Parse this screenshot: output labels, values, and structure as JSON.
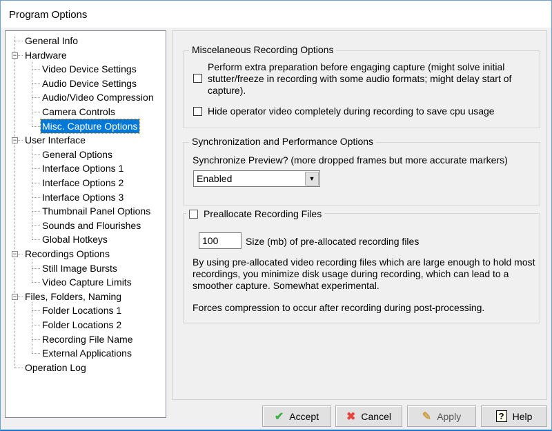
{
  "window": {
    "title": "Program Options"
  },
  "tree": [
    {
      "label": "General Info",
      "level": 0
    },
    {
      "label": "Hardware",
      "level": 0,
      "expander": "minus"
    },
    {
      "label": "Video Device Settings",
      "level": 1
    },
    {
      "label": "Audio Device Settings",
      "level": 1
    },
    {
      "label": "Audio/Video Compression",
      "level": 1
    },
    {
      "label": "Camera Controls",
      "level": 1
    },
    {
      "label": "Misc. Capture Options",
      "level": 1,
      "selected": true
    },
    {
      "label": "User Interface",
      "level": 0,
      "expander": "minus"
    },
    {
      "label": "General Options",
      "level": 1
    },
    {
      "label": "Interface Options 1",
      "level": 1
    },
    {
      "label": "Interface Options 2",
      "level": 1
    },
    {
      "label": "Interface Options 3",
      "level": 1
    },
    {
      "label": "Thumbnail Panel Options",
      "level": 1
    },
    {
      "label": "Sounds and Flourishes",
      "level": 1
    },
    {
      "label": "Global Hotkeys",
      "level": 1
    },
    {
      "label": "Recordings Options",
      "level": 0,
      "expander": "minus"
    },
    {
      "label": "Still Image Bursts",
      "level": 1
    },
    {
      "label": "Video Capture Limits",
      "level": 1
    },
    {
      "label": "Files, Folders, Naming",
      "level": 0,
      "expander": "minus"
    },
    {
      "label": "Folder Locations 1",
      "level": 1
    },
    {
      "label": "Folder Locations 2",
      "level": 1
    },
    {
      "label": "Recording File Name",
      "level": 1
    },
    {
      "label": "External Applications",
      "level": 1
    },
    {
      "label": "Operation Log",
      "level": 0
    }
  ],
  "misc": {
    "title": "Miscelaneous Recording Options",
    "opt1": {
      "line1": "Perform extra preparation before engaging capture (might solve initial",
      "line2": "stutter/freeze in recording with some audio formats; might delay start of",
      "line3": "capture).",
      "checked": false
    },
    "opt2": {
      "label": "Hide operator video completely during recording to save cpu usage",
      "checked": false
    }
  },
  "sync": {
    "title": "Synchronization and Performance Options",
    "label": "Synchronize Preview? (more dropped frames but more accurate markers)",
    "value": "Enabled"
  },
  "prealloc": {
    "title": "Preallocate Recording Files",
    "checked": false,
    "size_value": "100",
    "size_label": "Size (mb) of pre-allocated recording files",
    "desc1": "By using pre-allocated video recording files which are large enough to hold most",
    "desc2": "recordings, you minimize disk usage during recording, which can lead to a",
    "desc3": "smoother capture.  Somewhat experimental.",
    "note": "Forces compression to occur after recording during post-processing."
  },
  "buttons": {
    "accept": "Accept",
    "cancel": "Cancel",
    "apply": "Apply",
    "help": "Help"
  },
  "colors": {
    "selection": "#0078d7",
    "accept_icon": "#3cb043",
    "cancel_icon": "#e8453c"
  }
}
